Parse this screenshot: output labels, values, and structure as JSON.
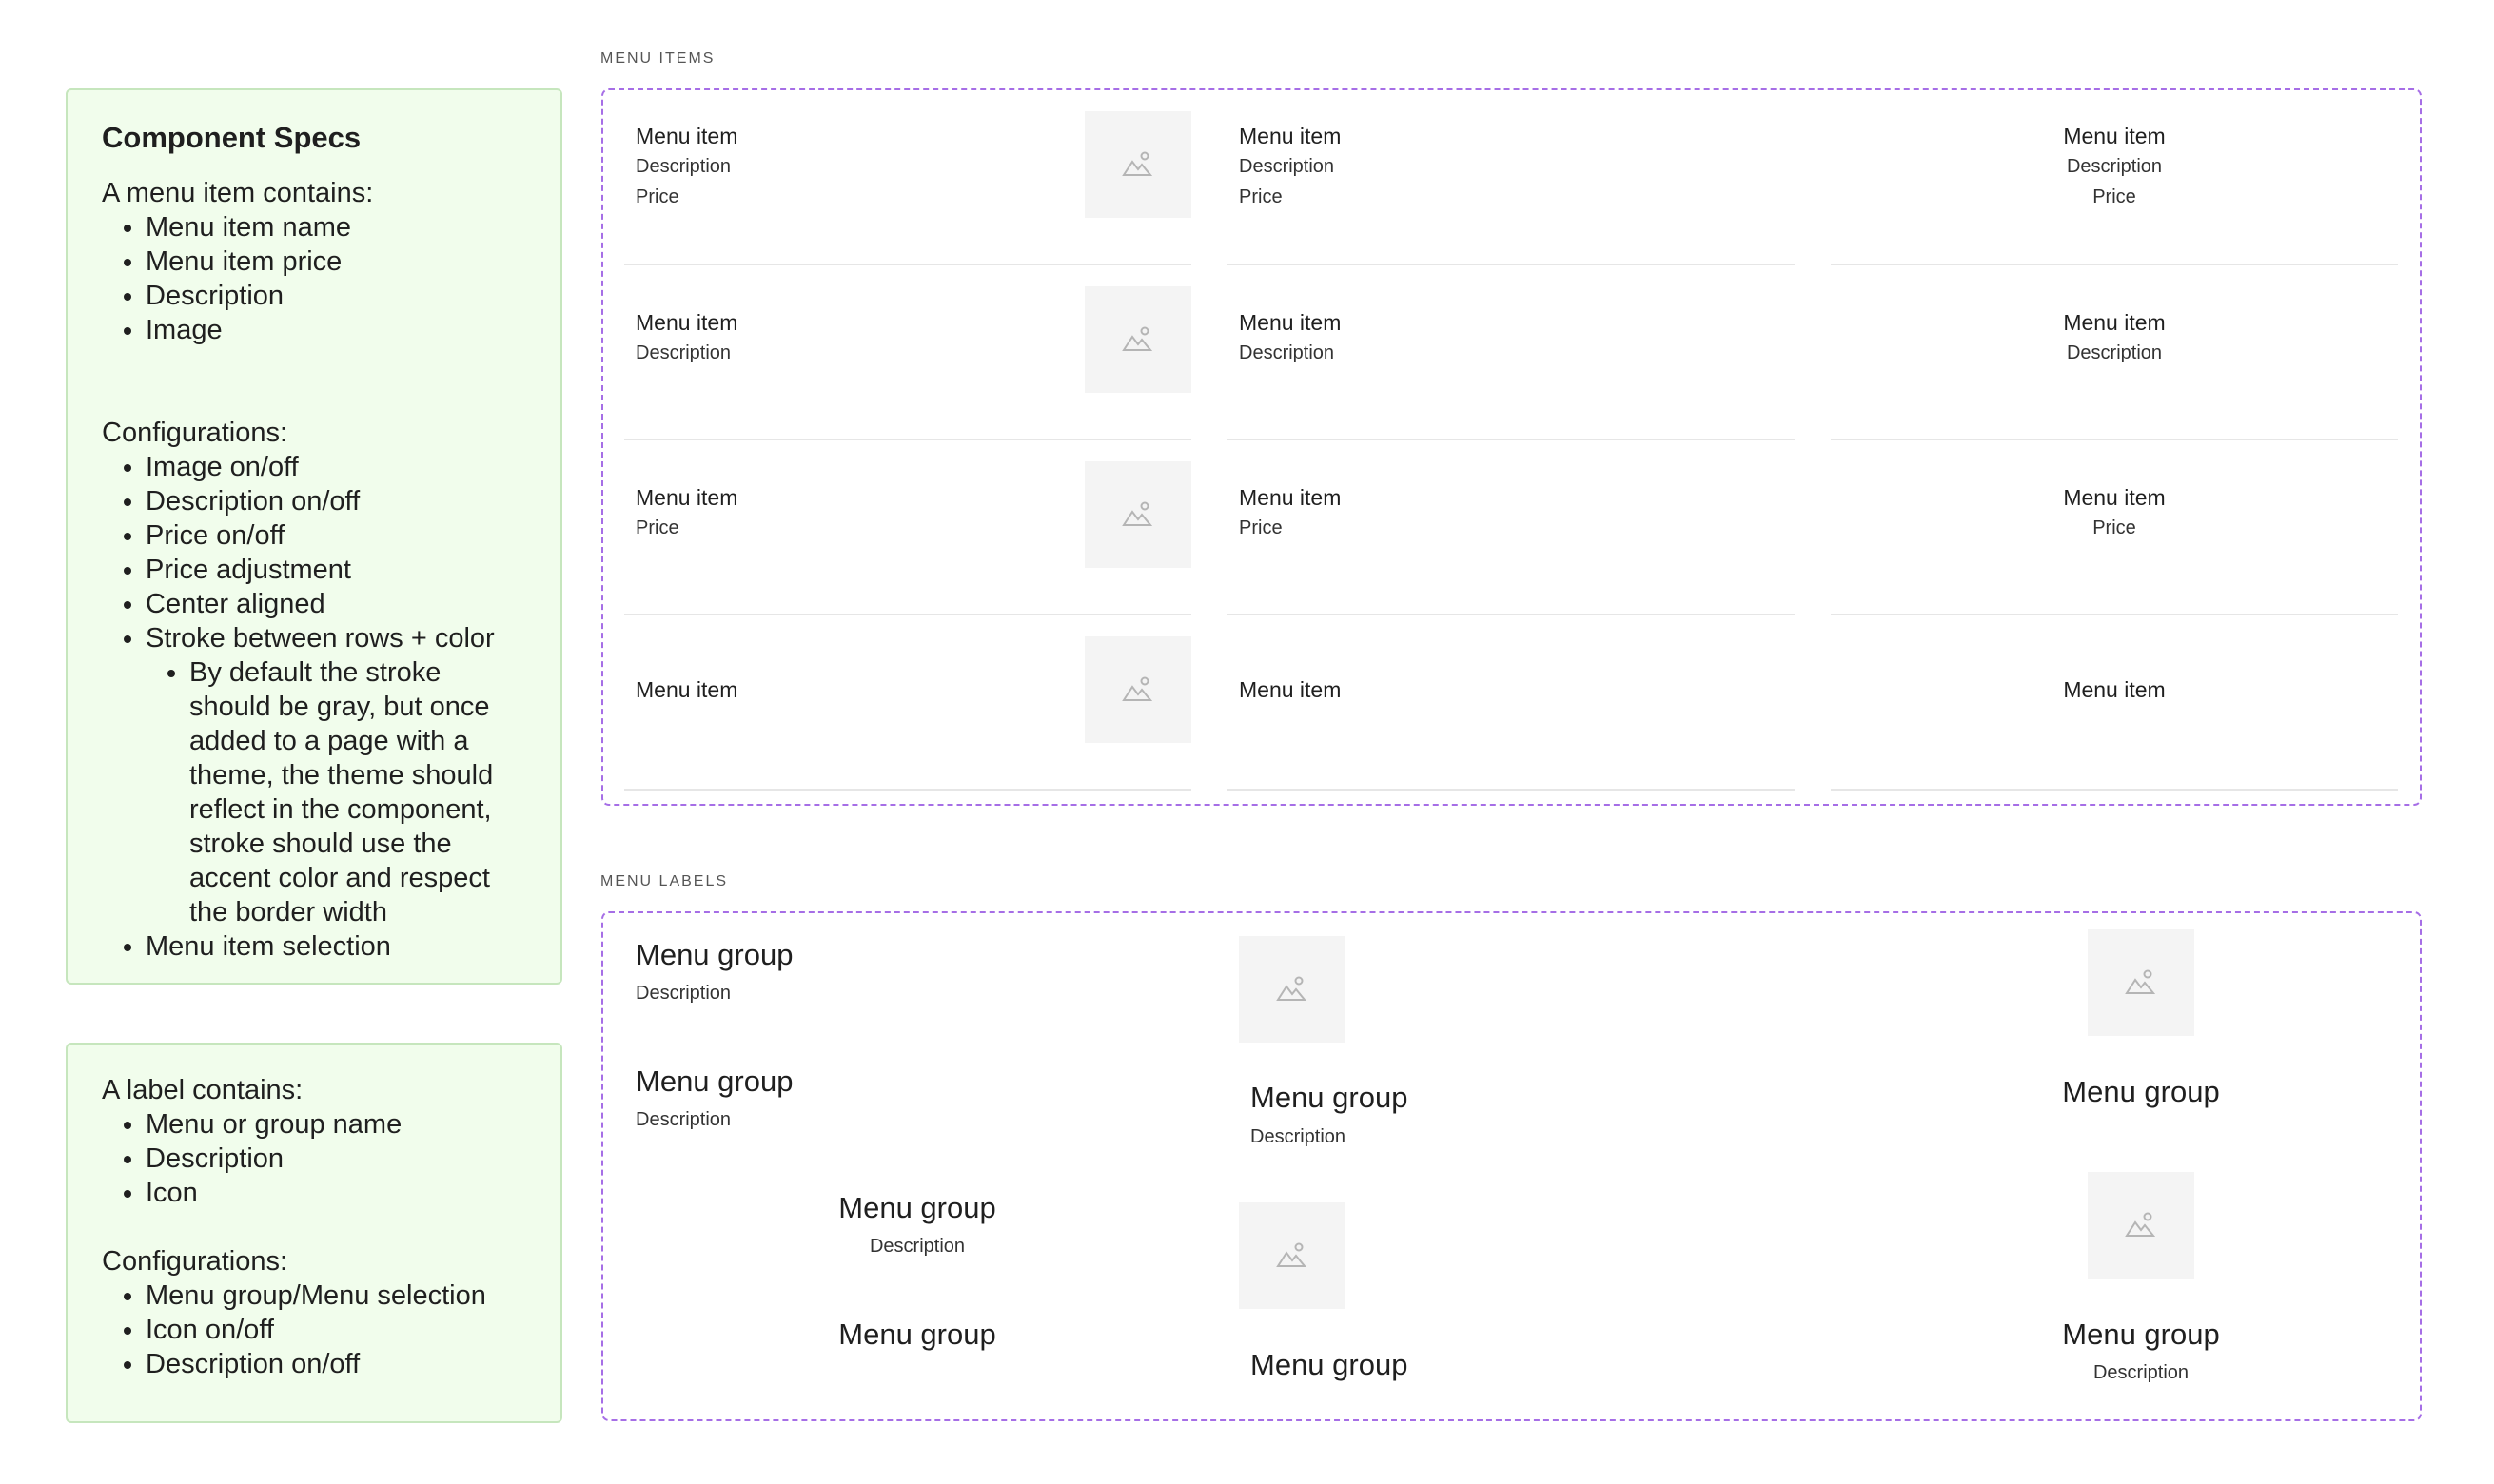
{
  "specs_note": {
    "title": "Component Specs",
    "intro": "A menu item contains:",
    "contains": [
      "Menu item name",
      "Menu item price",
      "Description",
      "Image"
    ],
    "config_title": "Configurations:",
    "configs": [
      "Image on/off",
      "Description on/off",
      "Price on/off",
      "Price adjustment",
      "Center aligned",
      "Stroke between rows + color"
    ],
    "stroke_detail": "By default the stroke should be gray, but once added to a page with a theme, the theme should reflect in the component, stroke should use the accent color and respect the border width",
    "last_config": "Menu item selection"
  },
  "label_note": {
    "intro": "A label contains:",
    "contains": [
      "Menu or group name",
      "Description",
      "Icon"
    ],
    "config_title": "Configurations:",
    "configs": [
      "Menu group/Menu selection",
      "Icon on/off",
      "Description on/off"
    ]
  },
  "menu_items_section": {
    "label": "MENU ITEMS",
    "item_name": "Menu item",
    "description": "Description",
    "price": "Price"
  },
  "menu_labels_section": {
    "label": "MENU LABELS",
    "group_name": "Menu group",
    "description": "Description"
  },
  "colors": {
    "frame_border": "#a66ee6",
    "note_bg": "#f1fdec",
    "note_border": "#c6e6bd",
    "divider": "#e6e6e6",
    "placeholder_bg": "#f4f4f4"
  },
  "icons": {
    "image_placeholder": "image-placeholder-icon"
  }
}
